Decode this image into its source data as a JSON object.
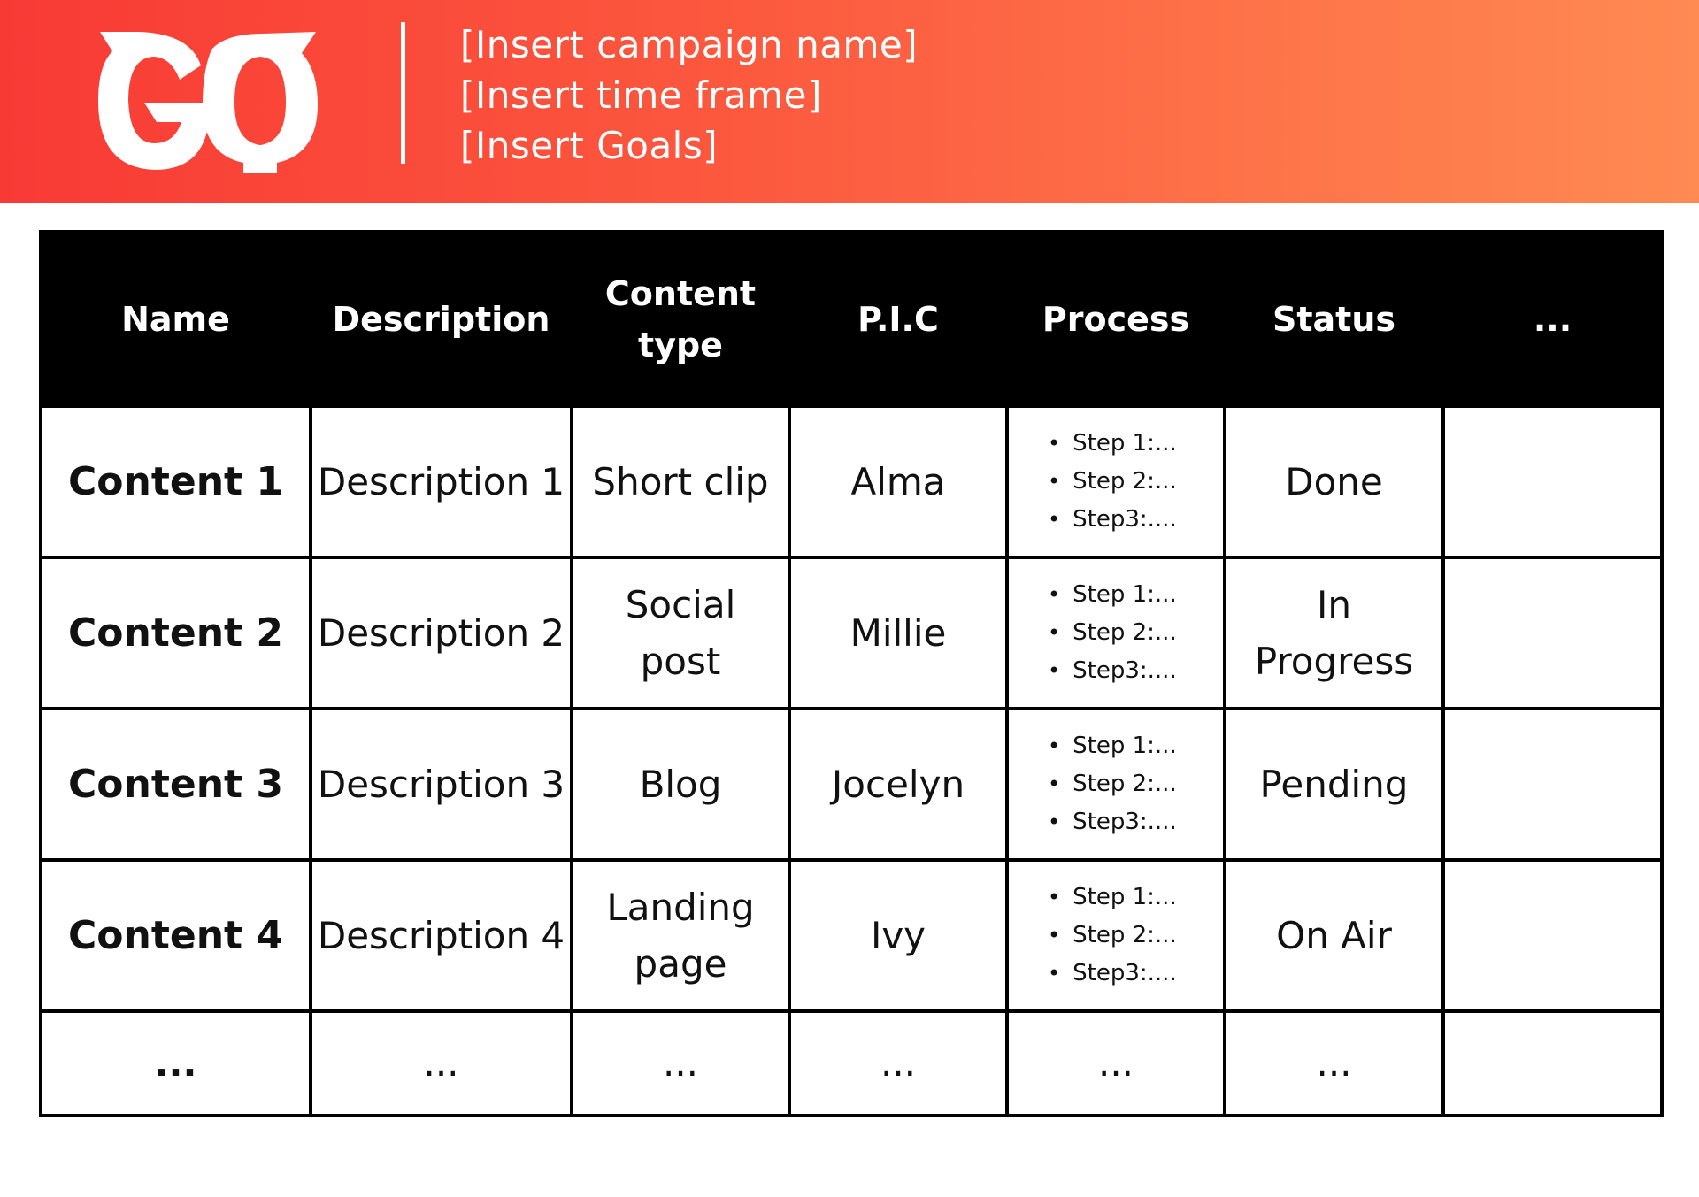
{
  "header": {
    "logo_text": "GQ",
    "lines": [
      "[Insert campaign name]",
      "[Insert time frame]",
      "[Insert  Goals]"
    ],
    "gradient_colors": [
      "#f83a35",
      "#ff8a52"
    ]
  },
  "table": {
    "columns": [
      "Name",
      "Description",
      "Content type",
      "P.I.C",
      "Process",
      "Status",
      "..."
    ],
    "rows": [
      {
        "name": "Content 1",
        "description": "Description 1",
        "content_type": "Short clip",
        "pic": "Alma",
        "process": [
          "Step 1:...",
          "Step 2:...",
          "Step3:...."
        ],
        "status": "Done",
        "extra": ""
      },
      {
        "name": "Content 2",
        "description": "Description 2",
        "content_type": "Social post",
        "pic": "Millie",
        "process": [
          "Step 1:...",
          "Step 2:...",
          "Step3:...."
        ],
        "status": "In Progress",
        "extra": ""
      },
      {
        "name": "Content 3",
        "description": "Description 3",
        "content_type": "Blog",
        "pic": "Jocelyn",
        "process": [
          "Step 1:...",
          "Step 2:...",
          "Step3:...."
        ],
        "status": "Pending",
        "extra": ""
      },
      {
        "name": "Content 4",
        "description": "Description 4",
        "content_type": "Landing page",
        "pic": "Ivy",
        "process": [
          "Step 1:...",
          "Step 2:...",
          "Step3:...."
        ],
        "status": "On Air",
        "extra": ""
      }
    ],
    "last_row": [
      "...",
      "...",
      "...",
      "...",
      "...",
      "...",
      ""
    ]
  }
}
